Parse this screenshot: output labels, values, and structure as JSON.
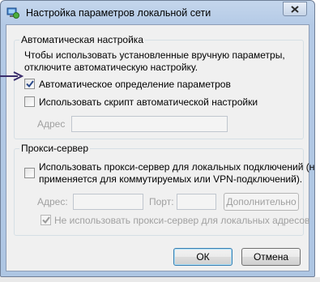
{
  "window": {
    "title": "Настройка параметров локальной сети",
    "close_icon": "close-x-icon",
    "app_icon": "network-settings-icon"
  },
  "auto_config": {
    "legend": "Автоматическая настройка",
    "description_line1": "Чтобы использовать установленные вручную параметры,",
    "description_line2": "отключите автоматическую настройку.",
    "auto_detect": {
      "label": "Автоматическое определение параметров",
      "checked": true
    },
    "use_script": {
      "label": "Использовать скрипт автоматической настройки",
      "checked": false
    },
    "address_label": "Адрес",
    "address_value": ""
  },
  "proxy": {
    "legend": "Прокси-сервер",
    "use_proxy": {
      "label_line1": "Использовать прокси-сервер для локальных подключений (не",
      "label_line2": "применяется для коммутируемых или VPN-подключений).",
      "checked": false
    },
    "address_label": "Адрес:",
    "address_value": "",
    "port_label": "Порт:",
    "port_value": "",
    "advanced_button": "Дополнительно",
    "bypass_local": {
      "label": "Не использовать прокси-сервер для локальных адресов",
      "checked": true
    }
  },
  "buttons": {
    "ok": "ОК",
    "cancel": "Отмена"
  },
  "colors": {
    "arrow": "#3a2d6b",
    "title_bar": "#b4cae6",
    "client": "#f0f0f0"
  }
}
